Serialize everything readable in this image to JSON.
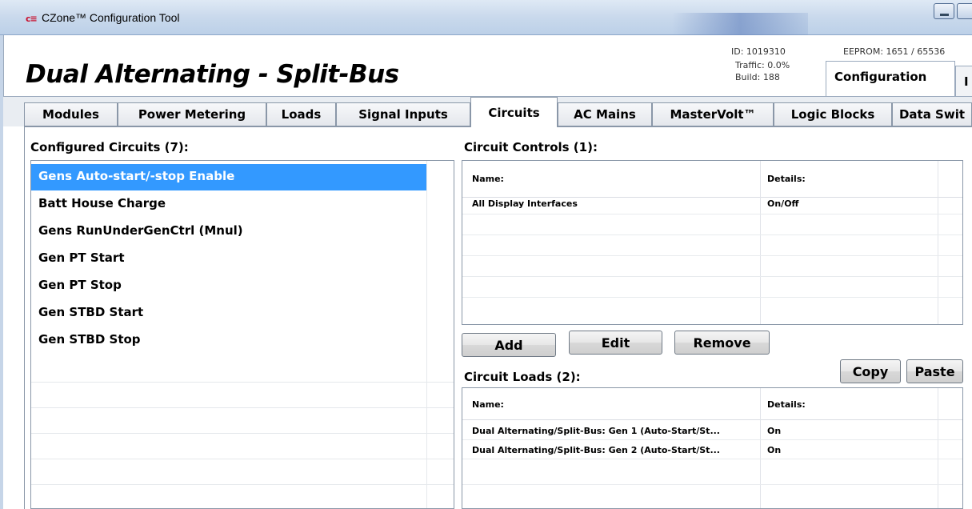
{
  "window": {
    "title": "CZone™ Configuration Tool",
    "logo_text": "c≡"
  },
  "header": {
    "doc_title": "Dual Alternating - Split-Bus",
    "id_text": "ID: 1019310",
    "traffic_text": "Traffic: 0.0%",
    "build_text": "Build: 188",
    "eeprom_text": "EEPROM: 1651 / 65536",
    "top_tabs": [
      {
        "label": "Configuration",
        "active": true
      },
      {
        "label": "I",
        "active": false
      }
    ]
  },
  "subtabs": [
    {
      "label": "Modules",
      "active": false
    },
    {
      "label": "Power Metering",
      "active": false
    },
    {
      "label": "Loads",
      "active": false
    },
    {
      "label": "Signal Inputs",
      "active": false
    },
    {
      "label": "Circuits",
      "active": true
    },
    {
      "label": "AC Mains",
      "active": false
    },
    {
      "label": "MasterVolt™",
      "active": false
    },
    {
      "label": "Logic Blocks",
      "active": false
    },
    {
      "label": "Data Swit",
      "active": false
    }
  ],
  "configured": {
    "heading": "Configured Circuits (7):",
    "items": [
      "Gens Auto-start/-stop Enable",
      "Batt House Charge",
      "Gens RunUnderGenCtrl (Mnul)",
      "Gen PT Start",
      "Gen PT Stop",
      "Gen STBD Start",
      "Gen STBD Stop"
    ],
    "selected_index": 0
  },
  "controls": {
    "heading": "Circuit Controls (1):",
    "col_name": "Name:",
    "col_details": "Details:",
    "rows": [
      {
        "name": "All Display Interfaces",
        "details": "On/Off"
      }
    ]
  },
  "buttons": {
    "add": "Add",
    "edit": "Edit",
    "remove": "Remove",
    "copy": "Copy",
    "paste": "Paste"
  },
  "loads": {
    "heading": "Circuit Loads (2):",
    "col_name": "Name:",
    "col_details": "Details:",
    "rows": [
      {
        "name": "Dual Alternating/Split-Bus: Gen 1 (Auto-Start/St...",
        "details": "On"
      },
      {
        "name": "Dual Alternating/Split-Bus: Gen 2 (Auto-Start/St...",
        "details": "On"
      }
    ]
  },
  "colors": {
    "selection": "#3399ff",
    "logo_red": "#c8102e"
  }
}
